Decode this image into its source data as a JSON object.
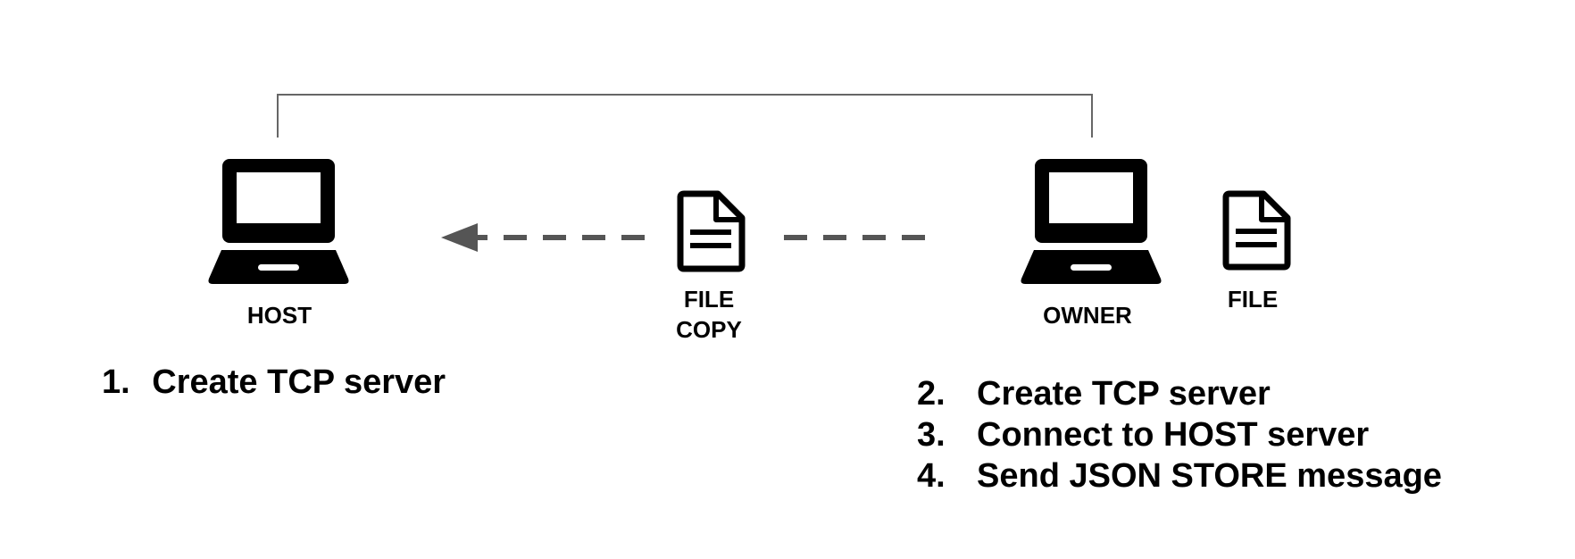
{
  "nodes": {
    "host": {
      "label": "HOST",
      "icon": "laptop-icon"
    },
    "owner": {
      "label": "OWNER",
      "icon": "laptop-icon"
    },
    "file_copy": {
      "line1": "FILE",
      "line2": "COPY",
      "icon": "document-icon"
    },
    "file": {
      "label": "FILE",
      "icon": "document-icon"
    }
  },
  "host_steps": [
    {
      "num": "1.",
      "text": "Create TCP server"
    }
  ],
  "owner_steps": [
    {
      "num": "2.",
      "text": "Create TCP server"
    },
    {
      "num": "3.",
      "text": "Connect to HOST server"
    },
    {
      "num": "4.",
      "text": "Send JSON STORE message"
    }
  ],
  "colors": {
    "icon": "#000000",
    "arrow": "#555555",
    "connector": "#666666",
    "text": "#000000"
  }
}
